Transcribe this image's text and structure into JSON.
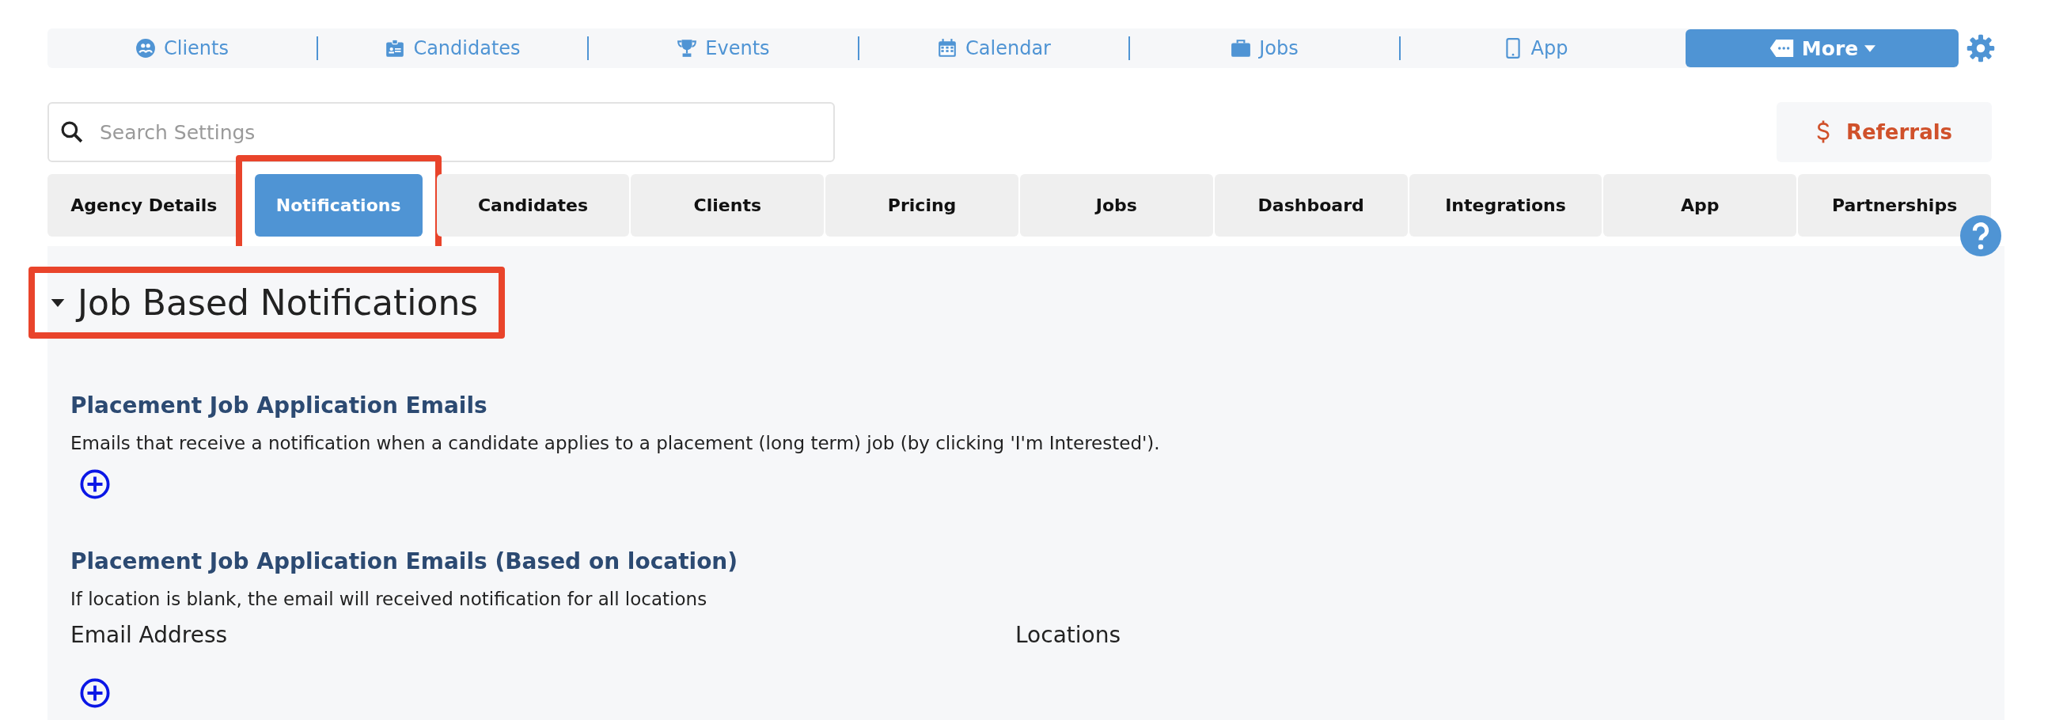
{
  "top_nav": {
    "items": [
      {
        "label": "Clients"
      },
      {
        "label": "Candidates"
      },
      {
        "label": "Events"
      },
      {
        "label": "Calendar"
      },
      {
        "label": "Jobs"
      },
      {
        "label": "App"
      }
    ],
    "more_button": "More"
  },
  "search": {
    "placeholder": "Search Settings"
  },
  "referrals_button": "Referrals",
  "tabs": [
    {
      "label": "Agency Details",
      "selected": false,
      "highlighted": false
    },
    {
      "label": "Notifications",
      "selected": true,
      "highlighted": true
    },
    {
      "label": "Candidates",
      "selected": false,
      "highlighted": false
    },
    {
      "label": "Clients",
      "selected": false,
      "highlighted": false
    },
    {
      "label": "Pricing",
      "selected": false,
      "highlighted": false
    },
    {
      "label": "Jobs",
      "selected": false,
      "highlighted": false
    },
    {
      "label": "Dashboard",
      "selected": false,
      "highlighted": false
    },
    {
      "label": "Integrations",
      "selected": false,
      "highlighted": false
    },
    {
      "label": "App",
      "selected": false,
      "highlighted": false
    },
    {
      "label": "Partnerships",
      "selected": false,
      "highlighted": false
    }
  ],
  "section": {
    "title": "Job Based Notifications",
    "expanded": true,
    "highlighted": true,
    "groups": [
      {
        "title": "Placement Job Application Emails",
        "description": "Emails that receive a notification when a candidate applies to a placement (long term) job (by clicking 'I'm Interested')."
      },
      {
        "title": "Placement Job Application Emails (Based on location)",
        "description": "If location is blank, the email will received notification for all locations",
        "columns": [
          "Email Address",
          "Locations"
        ]
      }
    ]
  }
}
